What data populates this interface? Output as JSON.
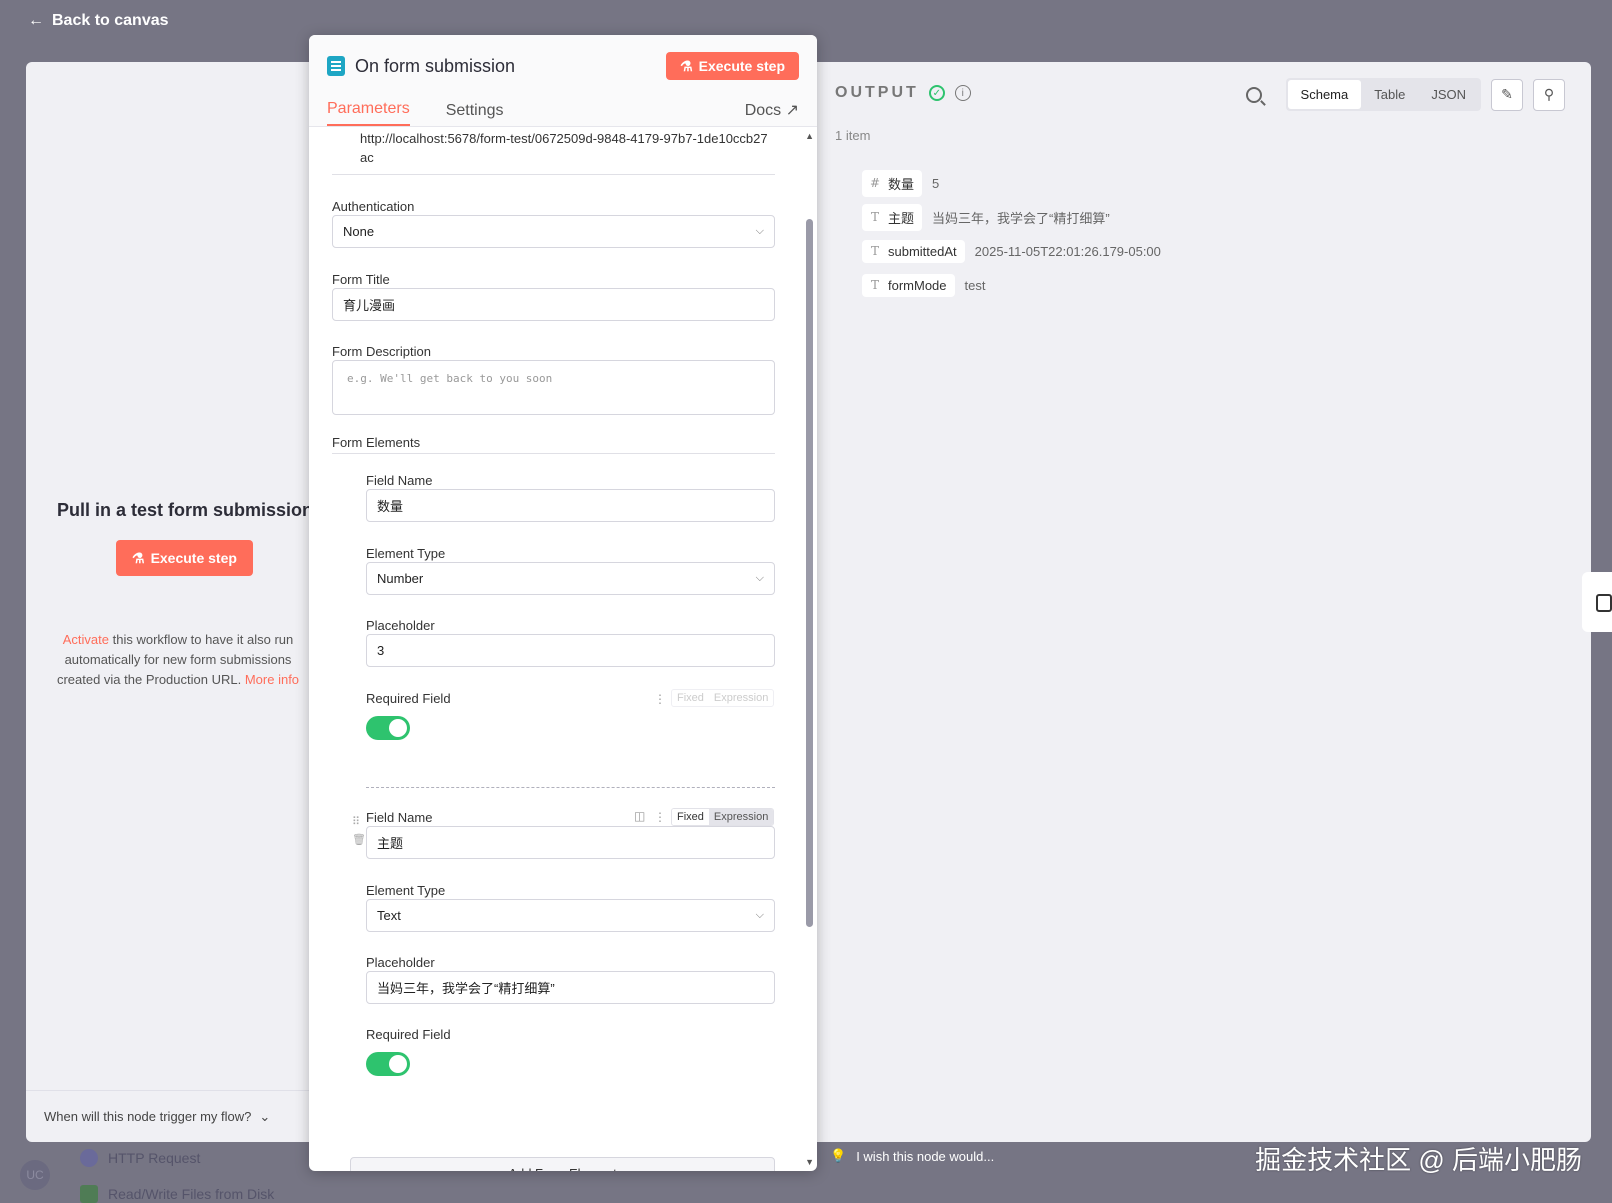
{
  "nav": {
    "back_label": "Back to canvas"
  },
  "left": {
    "title": "Pull in a test form submission",
    "execute_label": "Execute step",
    "note_link": "Activate",
    "note_text": "this workflow to have it also run",
    "note_line2": "automatically for new form submissions",
    "note_line3": "created via the Production URL.",
    "note_more": "More info",
    "footer": "When will this node trigger my flow?"
  },
  "node": {
    "title": "On form submission",
    "execute_label": "Execute step",
    "tabs": {
      "parameters": "Parameters",
      "settings": "Settings",
      "docs": "Docs"
    },
    "url": "http://localhost:5678/form-test/0672509d-9848-4179-97b7-1de10ccb27ac",
    "authentication": {
      "label": "Authentication",
      "value": "None"
    },
    "form_title": {
      "label": "Form Title",
      "value": "育儿漫画"
    },
    "form_description": {
      "label": "Form Description",
      "placeholder": "e.g. We'll get back to you soon"
    },
    "form_elements_label": "Form Elements",
    "elements": [
      {
        "field_name_label": "Field Name",
        "field_name": "数量",
        "type_label": "Element Type",
        "type": "Number",
        "placeholder_label": "Placeholder",
        "placeholder": "3",
        "required_label": "Required Field"
      },
      {
        "field_name_label": "Field Name",
        "field_name": "主题",
        "type_label": "Element Type",
        "type": "Text",
        "placeholder_label": "Placeholder",
        "placeholder": "当妈三年，我学会了“精打细算”",
        "required_label": "Required Field"
      }
    ],
    "fixed": "Fixed",
    "expression": "Expression",
    "add_element": "Add Form Element"
  },
  "output": {
    "title": "OUTPUT",
    "item_count": "1 item",
    "view_modes": [
      "Schema",
      "Table",
      "JSON"
    ],
    "fields": [
      {
        "type_icon": "#",
        "key": "数量",
        "value": "5"
      },
      {
        "type_icon": "T",
        "key": "主题",
        "value": "当妈三年，我学会了“精打细算”"
      },
      {
        "type_icon": "T",
        "key": "submittedAt",
        "value": "2025-11-05T22:01:26.179-05:00"
      },
      {
        "type_icon": "T",
        "key": "formMode",
        "value": "test"
      }
    ],
    "wish": "I wish this node would..."
  },
  "background": {
    "nodes": [
      "HTTP Request",
      "Read/Write Files from Disk"
    ]
  },
  "watermark": "掘金技术社区 @ 后端小肥肠",
  "colors": {
    "accent": "#ff6d5a",
    "success": "#2ec36e"
  }
}
